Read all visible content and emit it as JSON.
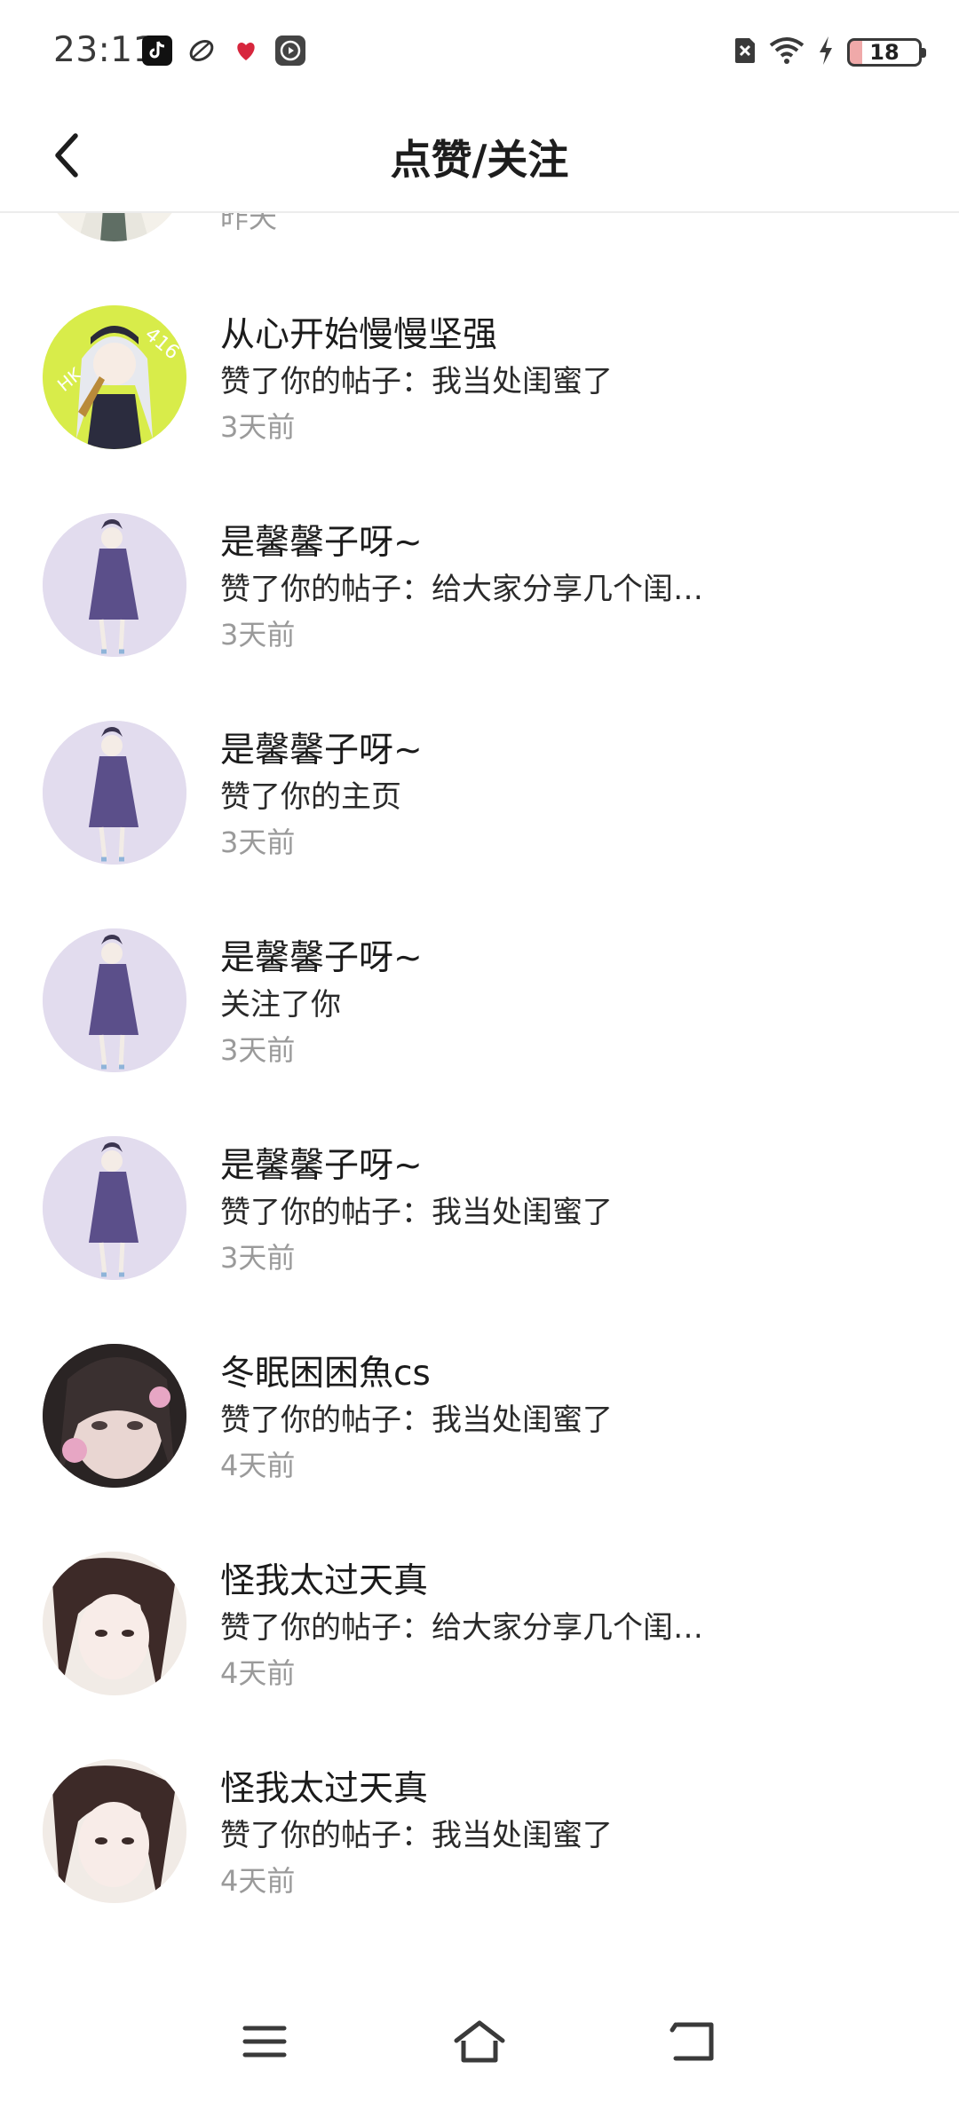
{
  "status_bar": {
    "time": "23:11",
    "battery": "18",
    "left_icons": [
      "tiktok-icon",
      "leaf-app-icon",
      "red-app-icon",
      "video-app-icon"
    ],
    "right_icons": [
      "sim-off-icon",
      "wifi-icon",
      "charging-icon",
      "battery-icon"
    ]
  },
  "header": {
    "title": "点赞/关注",
    "back_icon": "chevron-left-icon"
  },
  "list": {
    "partial_top_item": {
      "time": "昨天"
    },
    "items": [
      {
        "name": "从心开始慢慢坚强",
        "action": "赞了你的帖子：我当处闺蜜了",
        "time": "3天前",
        "avatar": "anime-girl-green"
      },
      {
        "name": "是馨馨子呀~",
        "action": "赞了你的帖子：给大家分享几个闺…",
        "time": "3天前",
        "avatar": "anime-girl-lavender"
      },
      {
        "name": "是馨馨子呀~",
        "action": "赞了你的主页",
        "time": "3天前",
        "avatar": "anime-girl-lavender"
      },
      {
        "name": "是馨馨子呀~",
        "action": "关注了你",
        "time": "3天前",
        "avatar": "anime-girl-lavender"
      },
      {
        "name": "是馨馨子呀~",
        "action": "赞了你的帖子：我当处闺蜜了",
        "time": "3天前",
        "avatar": "anime-girl-lavender"
      },
      {
        "name": "冬眠困困魚cs",
        "action": "赞了你的帖子：我当处闺蜜了",
        "time": "4天前",
        "avatar": "photo-girl-dark"
      },
      {
        "name": "怪我太过天真",
        "action": "赞了你的帖子：给大家分享几个闺…",
        "time": "4天前",
        "avatar": "photo-girl-light"
      },
      {
        "name": "怪我太过天真",
        "action": "赞了你的帖子：我当处闺蜜了",
        "time": "4天前",
        "avatar": "photo-girl-light"
      }
    ]
  },
  "nav_bar": {
    "menu_icon": "menu-icon",
    "home_icon": "home-icon",
    "back_icon": "back-icon"
  },
  "colors": {
    "text_primary": "#1b1b1b",
    "text_secondary": "#9a9a9a",
    "divider": "#ececec",
    "avatar_lavender": "#e2dcee",
    "avatar_green": "#d8ec4a"
  }
}
